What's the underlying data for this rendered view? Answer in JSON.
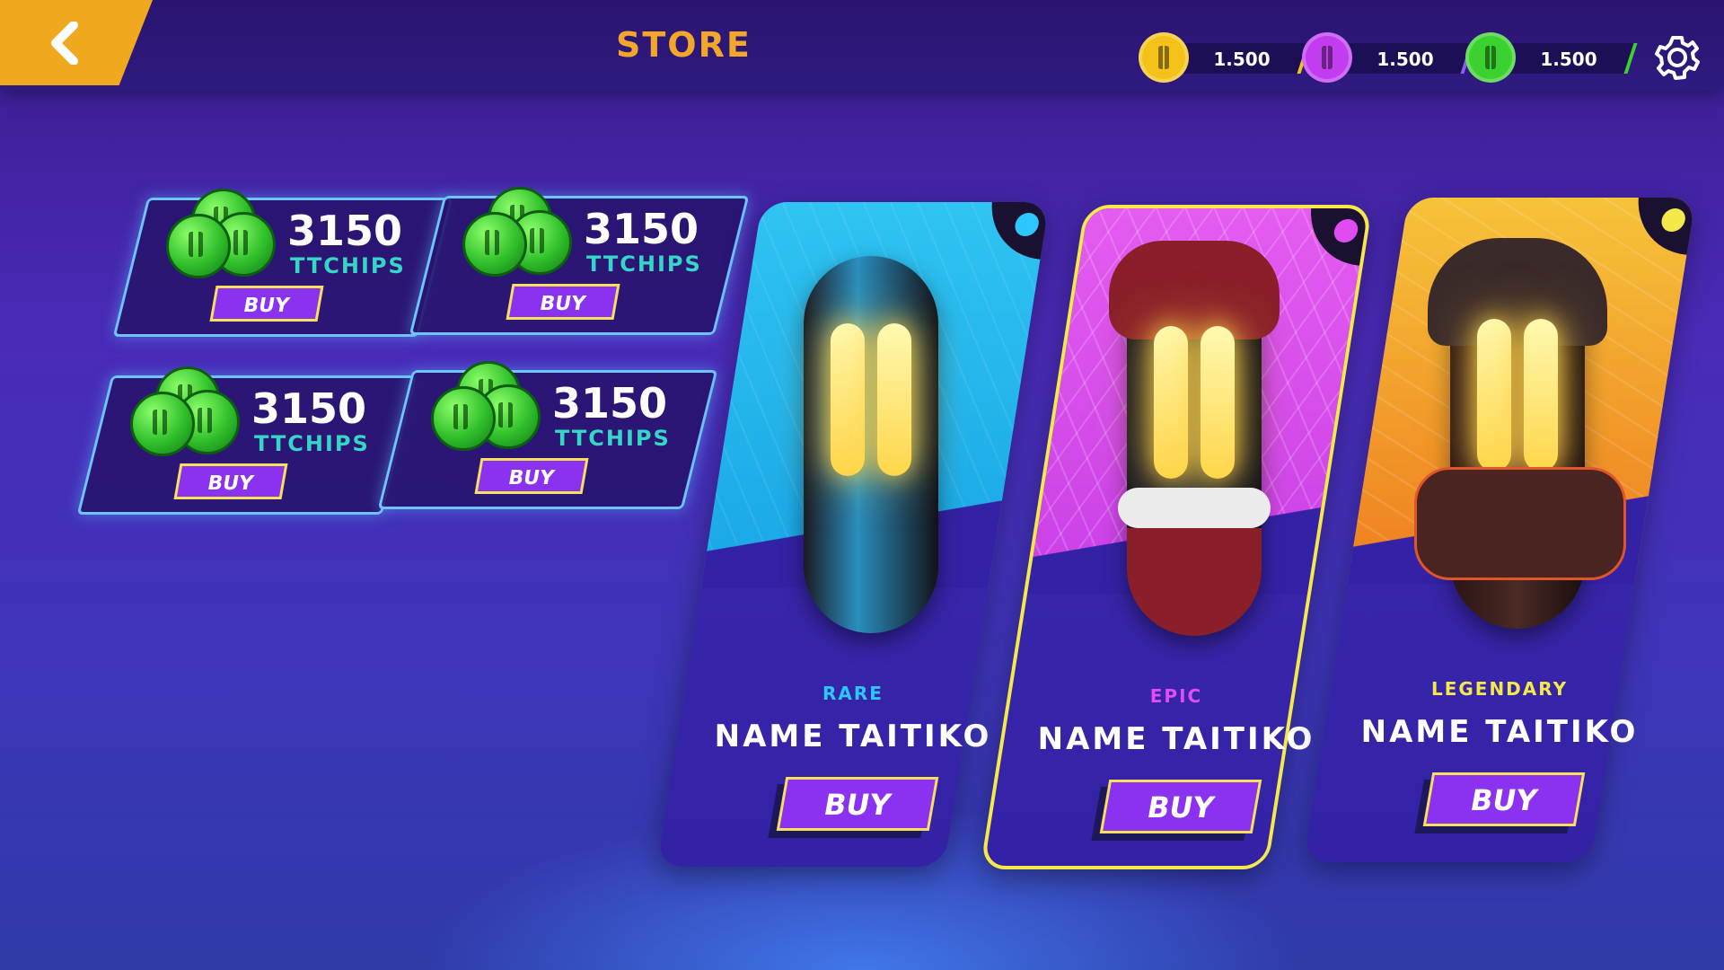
{
  "header": {
    "title": "STORE",
    "currencies": [
      {
        "name": "gold-coin",
        "value": "1.500",
        "color": "#f5c21a",
        "accent": "#f5c21a"
      },
      {
        "name": "purple-coin",
        "value": "1.500",
        "color": "#c23cf0",
        "accent": "#8a5cf0"
      },
      {
        "name": "green-coin",
        "value": "1.500",
        "color": "#3bd12f",
        "accent": "#3bd12f"
      }
    ]
  },
  "packs": [
    {
      "amount": "3150",
      "unit": "TTCHIPS",
      "buy_label": "BUY"
    },
    {
      "amount": "3150",
      "unit": "TTCHIPS",
      "buy_label": "BUY"
    },
    {
      "amount": "3150",
      "unit": "TTCHIPS",
      "buy_label": "BUY"
    },
    {
      "amount": "3150",
      "unit": "TTCHIPS",
      "buy_label": "BUY"
    }
  ],
  "characters": [
    {
      "rarity": "RARE",
      "name": "NAME TAITIKO",
      "buy_label": "BUY",
      "rarity_color": "#2ec6ff",
      "dot_color": "#2ec6ff"
    },
    {
      "rarity": "EPIC",
      "name": "NAME TAITIKO",
      "buy_label": "BUY",
      "rarity_color": "#e04cf2",
      "dot_color": "#e04cf2"
    },
    {
      "rarity": "LEGENDARY",
      "name": "NAME TAITIKO",
      "buy_label": "BUY",
      "rarity_color": "#f5e84a",
      "dot_color": "#f5e84a"
    }
  ]
}
